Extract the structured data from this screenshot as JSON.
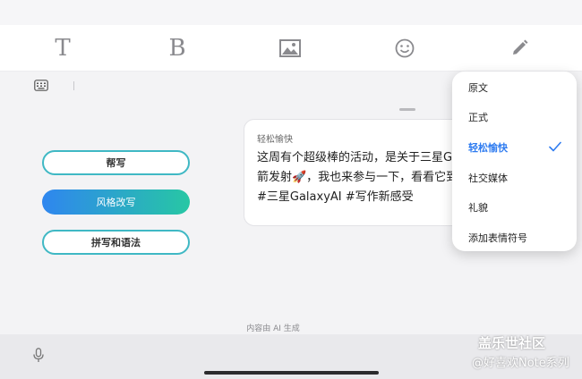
{
  "toolbar": {
    "text_tool": "T",
    "bold_tool": "B",
    "icons": [
      "text-icon",
      "bold-icon",
      "image-icon",
      "emoji-icon",
      "pen-icon"
    ]
  },
  "subbar": {
    "icons": [
      "keyboard-icon"
    ]
  },
  "actions": {
    "write": "帮写",
    "restyle": "风格改写",
    "spelling": "拼写和语法"
  },
  "preview": {
    "title": "轻松愉快",
    "lines": [
      "这周有个超级棒的活动，是关于三星Ga",
      "箭发射🚀，我也来参与一下，看看它到",
      "#三星GalaxyAI #写作新感受"
    ]
  },
  "style_menu": {
    "items": [
      "原文",
      "正式",
      "轻松愉快",
      "社交媒体",
      "礼貌",
      "添加表情符号"
    ],
    "selected": "轻松愉快"
  },
  "footer": {
    "ai_note": "内容由 AI 生成"
  },
  "watermark": {
    "line1": "盖乐世社区",
    "line2": "@好喜欢Note系列"
  },
  "colors": {
    "accent": "#2f7cf0",
    "gradient_start": "#2f86ef",
    "gradient_end": "#27c7a4",
    "outline": "#3fb8c4"
  }
}
